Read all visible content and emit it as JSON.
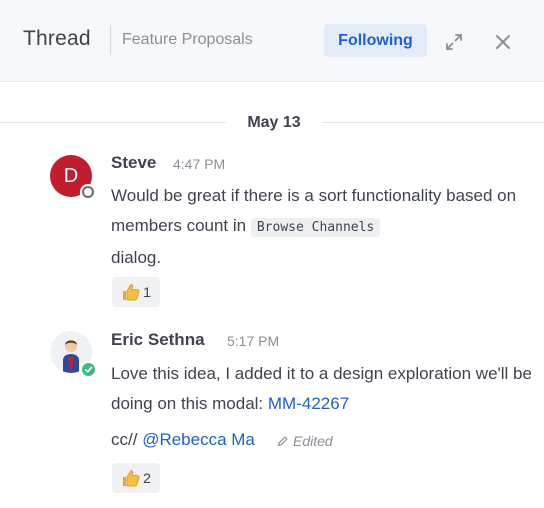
{
  "header": {
    "title": "Thread",
    "channel": "Feature Proposals",
    "follow_label": "Following",
    "expand_icon": "expand-icon",
    "close_icon": "close-icon"
  },
  "date_separator": "May 13",
  "posts": [
    {
      "author": "Steve",
      "time": "4:47 PM",
      "avatar_initial": "D",
      "status": "away",
      "text_before": "Would be great if there is a sort functionality based on members count in",
      "code": "Browse Channels",
      "text_after": "dialog.",
      "reaction": {
        "emoji": "thumbsup",
        "count": "1"
      }
    },
    {
      "author": "Eric Sethna",
      "time": "5:17 PM",
      "status": "online",
      "text_before": "Love this idea, I added it to a design exploration we'll be doing on this modal:",
      "link": "MM-42267",
      "cc_prefix": "cc//",
      "mention": "@Rebecca Ma",
      "edited_label": "Edited",
      "reaction": {
        "emoji": "thumbsup",
        "count": "2"
      }
    }
  ],
  "colors": {
    "accent": "#1e5fd4",
    "avatar_red": "#c21d2c",
    "online": "#3db887"
  }
}
